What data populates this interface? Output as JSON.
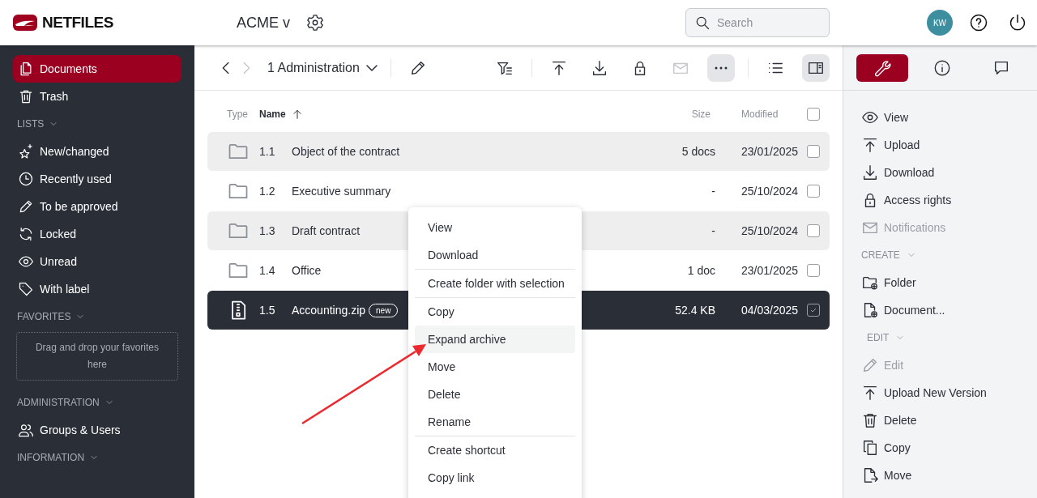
{
  "header": {
    "logo": "NETFILES",
    "workspace": "ACME v",
    "search": {
      "placeholder": "Search"
    },
    "avatar": "KW"
  },
  "sidebar": {
    "items": [
      {
        "label": "Documents",
        "kind": "documents",
        "selected": true
      },
      {
        "label": "Trash",
        "kind": "trash",
        "selected": false
      }
    ],
    "sections": [
      {
        "title": "LISTS",
        "items": [
          {
            "label": "New/changed",
            "kind": "sparkle",
            "selected": false
          },
          {
            "label": "Recently used",
            "kind": "clock",
            "selected": false
          },
          {
            "label": "To be approved",
            "kind": "pencil",
            "selected": false
          },
          {
            "label": "Locked",
            "kind": "refresh",
            "selected": false
          },
          {
            "label": "Unread",
            "kind": "eye",
            "selected": false
          },
          {
            "label": "With label",
            "kind": "tag",
            "selected": false
          }
        ]
      },
      {
        "title": "FAVORITES",
        "dropzone": "Drag and drop your favorites here"
      },
      {
        "title": "ADMINISTRATION",
        "items": [
          {
            "label": "Groups & Users",
            "kind": "users",
            "selected": false
          }
        ]
      },
      {
        "title": "INFORMATION"
      }
    ]
  },
  "toolbar": {
    "nav": [
      {
        "kind": "back",
        "disabled": false
      },
      {
        "kind": "forward",
        "disabled": true
      }
    ],
    "breadcrumb": "1 Administration",
    "groups": [
      [
        {
          "kind": "filter",
          "active": false,
          "disabled": false
        }
      ],
      [
        {
          "kind": "upload",
          "active": false,
          "disabled": false
        },
        {
          "kind": "download",
          "active": false,
          "disabled": false
        },
        {
          "kind": "lock",
          "active": false,
          "disabled": false
        },
        {
          "kind": "mail",
          "active": false,
          "disabled": true
        },
        {
          "kind": "more",
          "active": true,
          "disabled": false
        }
      ],
      [
        {
          "kind": "list",
          "active": false,
          "disabled": false
        },
        {
          "kind": "panel",
          "active": true,
          "disabled": false
        }
      ]
    ]
  },
  "table": {
    "columns": [
      {
        "label": "Type",
        "sorted": false
      },
      {
        "label": "Name",
        "sorted": true
      },
      {
        "label": "Size",
        "sorted": false
      },
      {
        "label": "Modified",
        "sorted": false
      }
    ],
    "all_checked": false,
    "rows": [
      {
        "kind": "folder",
        "number": "1.1",
        "name": "Object of the contract",
        "size": "5 docs",
        "modified": "23/01/2025",
        "checked": false,
        "selected": false
      },
      {
        "kind": "folder",
        "number": "1.2",
        "name": "Executive summary",
        "size": "-",
        "modified": "25/10/2024",
        "checked": false,
        "selected": false
      },
      {
        "kind": "folder",
        "number": "1.3",
        "name": "Draft contract",
        "size": "-",
        "modified": "25/10/2024",
        "checked": false,
        "selected": false
      },
      {
        "kind": "folder",
        "number": "1.4",
        "name": "Office",
        "size": "1 doc",
        "modified": "23/01/2025",
        "checked": false,
        "selected": false
      },
      {
        "kind": "zip",
        "number": "1.5",
        "name": "Accounting.zip",
        "badge": "new",
        "size": "52.4 KB",
        "modified": "04/03/2025",
        "checked": true,
        "selected": true
      }
    ]
  },
  "context_menu": {
    "groups": [
      [
        {
          "label": "View",
          "highlighted": false
        },
        {
          "label": "Download",
          "highlighted": false
        }
      ],
      [
        {
          "label": "Create folder with selection",
          "highlighted": false
        }
      ],
      [
        {
          "label": "Copy",
          "highlighted": false
        },
        {
          "label": "Expand archive",
          "highlighted": true
        },
        {
          "label": "Move",
          "highlighted": false
        },
        {
          "label": "Delete",
          "highlighted": false
        },
        {
          "label": "Rename",
          "highlighted": false
        }
      ],
      [
        {
          "label": "Create shortcut",
          "highlighted": false
        },
        {
          "label": "Copy link",
          "highlighted": false
        }
      ]
    ]
  },
  "panel": {
    "tabs": [
      {
        "kind": "wrench",
        "selected": true
      },
      {
        "kind": "info",
        "selected": false
      },
      {
        "kind": "comment",
        "selected": false
      }
    ],
    "sections": [
      {
        "items": [
          {
            "label": "View",
            "kind": "eye",
            "disabled": false
          },
          {
            "label": "Upload",
            "kind": "upload",
            "disabled": false
          },
          {
            "label": "Download",
            "kind": "download",
            "disabled": false
          },
          {
            "label": "Access rights",
            "kind": "lock",
            "disabled": false
          },
          {
            "label": "Notifications",
            "kind": "mail",
            "disabled": true
          }
        ]
      },
      {
        "title": "CREATE",
        "items": [
          {
            "label": "Folder",
            "kind": "folderplus",
            "disabled": false
          },
          {
            "label": "Document...",
            "kind": "docplus",
            "disabled": false
          }
        ]
      },
      {
        "title": "EDIT",
        "items": [
          {
            "label": "Edit",
            "kind": "pencil",
            "disabled": true
          },
          {
            "label": "Upload New Version",
            "kind": "upload",
            "disabled": false
          },
          {
            "label": "Delete",
            "kind": "trash",
            "disabled": false
          },
          {
            "label": "Copy",
            "kind": "copy",
            "disabled": false
          },
          {
            "label": "Move",
            "kind": "move",
            "disabled": false
          }
        ]
      }
    ]
  }
}
